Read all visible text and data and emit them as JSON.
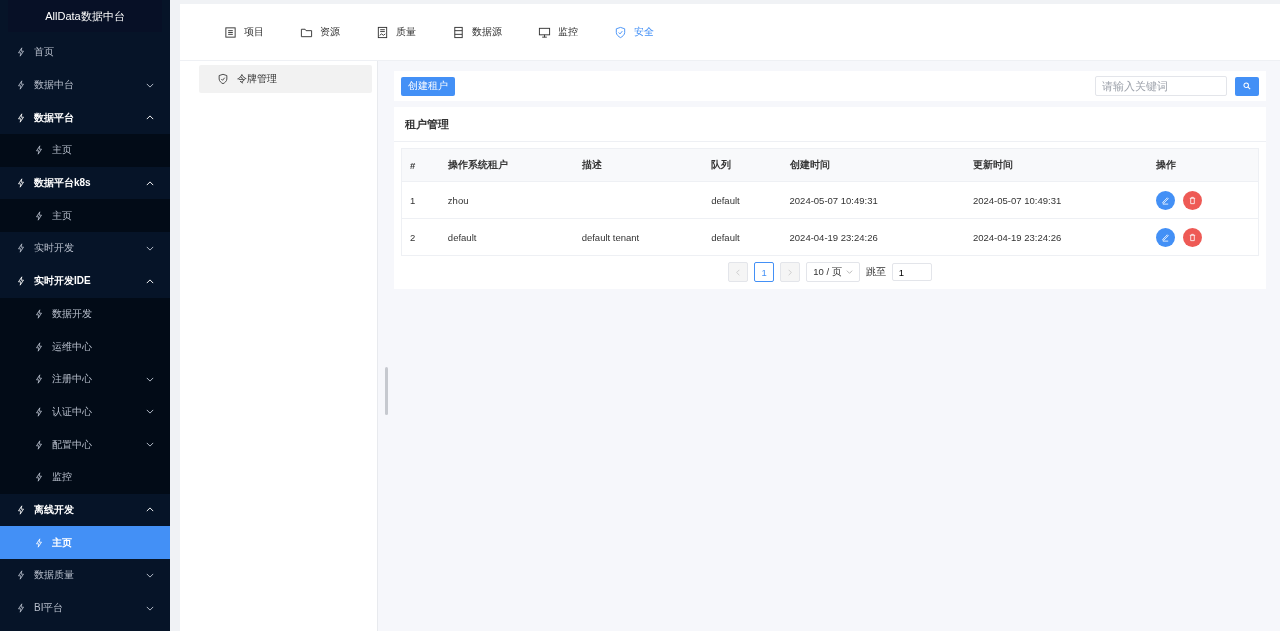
{
  "sidebar": {
    "title": "AllData数据中台",
    "items": [
      {
        "label": "首页",
        "selected": false
      },
      {
        "label": "数据中台",
        "expanded": false,
        "selected": false
      },
      {
        "label": "数据平台",
        "expanded": true,
        "selected": false,
        "children": [
          {
            "label": "主页",
            "selected": false
          }
        ]
      },
      {
        "label": "数据平台k8s",
        "expanded": true,
        "selected": false,
        "children": [
          {
            "label": "主页",
            "selected": false
          }
        ]
      },
      {
        "label": "实时开发",
        "expanded": false,
        "selected": false
      },
      {
        "label": "实时开发IDE",
        "expanded": true,
        "selected": false,
        "children": [
          {
            "label": "数据开发",
            "selected": false
          },
          {
            "label": "运维中心",
            "selected": false
          },
          {
            "label": "注册中心",
            "expanded": false,
            "selected": false
          },
          {
            "label": "认证中心",
            "expanded": false,
            "selected": false
          },
          {
            "label": "配置中心",
            "expanded": false,
            "selected": false
          },
          {
            "label": "监控",
            "selected": false
          }
        ]
      },
      {
        "label": "离线开发",
        "expanded": true,
        "selected": false,
        "children": [
          {
            "label": "主页",
            "selected": true
          }
        ]
      },
      {
        "label": "数据质量",
        "expanded": false,
        "selected": false
      },
      {
        "label": "BI平台",
        "expanded": false,
        "selected": false
      }
    ]
  },
  "top_tabs": [
    {
      "label": "项目",
      "selected": false
    },
    {
      "label": "资源",
      "selected": false
    },
    {
      "label": "质量",
      "selected": false
    },
    {
      "label": "数据源",
      "selected": false
    },
    {
      "label": "监控",
      "selected": false
    },
    {
      "label": "安全",
      "selected": true
    }
  ],
  "side_menu": [
    {
      "label": "令牌管理",
      "selected": true
    }
  ],
  "toolbar": {
    "create_button": "创建租户",
    "search": {
      "placeholder": "请输入关键词"
    }
  },
  "table": {
    "title": "租户管理",
    "columns": [
      "#",
      "操作系统租户",
      "描述",
      "队列",
      "创建时间",
      "更新时间",
      "操作"
    ],
    "rows": [
      [
        "1",
        "zhou",
        "",
        "default",
        "2024-05-07 10:49:31",
        "2024-05-07 10:49:31"
      ],
      [
        "2",
        "default",
        "default tenant",
        "default",
        "2024-04-19 23:24:26",
        "2024-04-19 23:24:26"
      ]
    ]
  },
  "pagination": {
    "pages": [
      {
        "label": "1",
        "selected": true
      }
    ],
    "page_size": "10 / 页",
    "jump_label": "跳至",
    "jump_value": "1"
  }
}
